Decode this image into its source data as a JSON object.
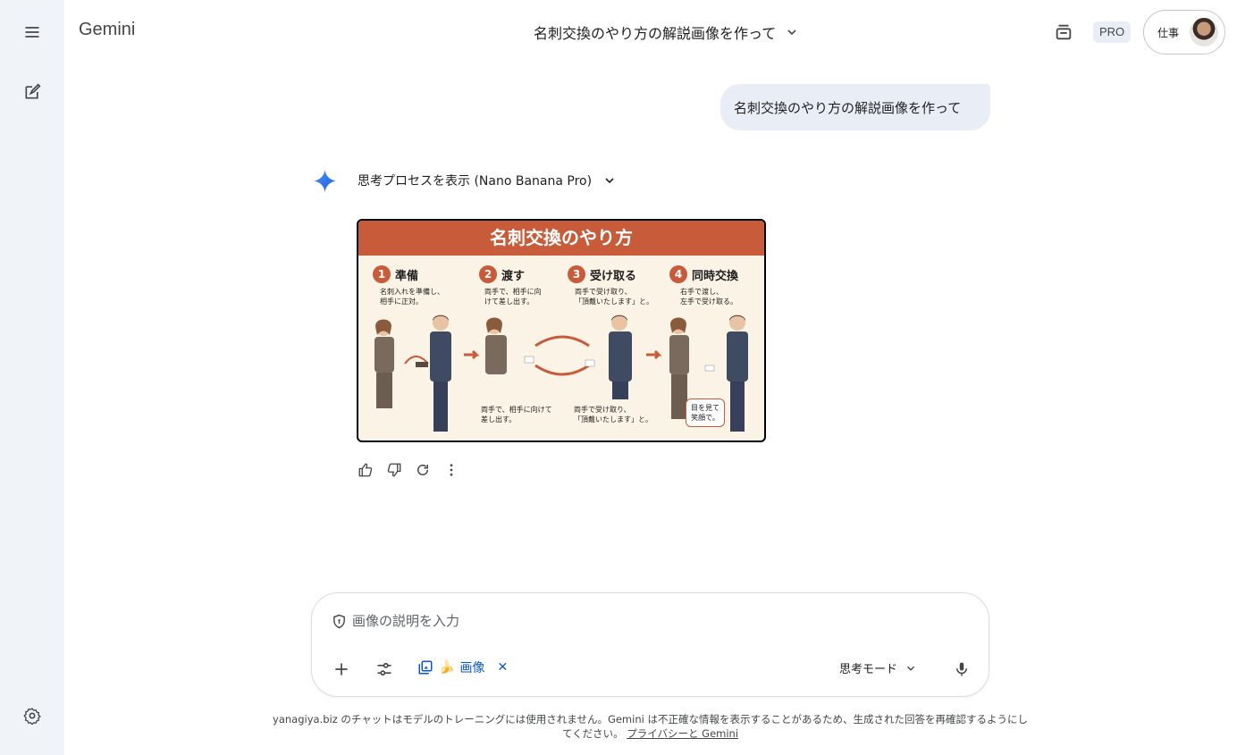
{
  "header": {
    "brand": "Gemini",
    "conversation_title": "名刺交換のやり方の解説画像を作って",
    "plan_badge": "PRO",
    "account_label": "仕事"
  },
  "sidebar": {
    "menu_icon": "menu-icon",
    "new_chat_icon": "edit-icon",
    "settings_icon": "gear-icon"
  },
  "chat": {
    "user_message": "名刺交換のやり方の解説画像を作って",
    "thought_toggle_label": "思考プロセスを表示 (Nano Banana Pro)",
    "image": {
      "title": "名刺交換のやり方",
      "steps": [
        {
          "num": "1",
          "title": "準備",
          "text": "名刺入れを準備し、\n相手に正対。"
        },
        {
          "num": "2",
          "title": "渡す",
          "text": "両手で、相手に向\nけて差し出す。"
        },
        {
          "num": "3",
          "title": "受け取る",
          "text": "両手で受け取り、\n「頂戴いたします」と。"
        },
        {
          "num": "4",
          "title": "同時交換",
          "text": "右手で渡し、\n左手で受け取る。"
        }
      ],
      "captions": {
        "give": "両手で、相手に向けて\n差し出す。",
        "receive": "両手で受け取り、\n「頂戴いたします」と。",
        "speech": "目を見て\n笑顔で。"
      }
    }
  },
  "composer": {
    "placeholder": "画像の説明を入力",
    "chip_emoji": "🍌",
    "chip_label": "画像",
    "chip_close": "✕",
    "mode_label": "思考モード"
  },
  "footer": {
    "disclaimer": "yanagiya.biz のチャットはモデルのトレーニングには使用されません。Gemini は不正確な情報を表示することがあるため、生成された回答を再確認するようにしてください。",
    "link_label": "プライバシーと Gemini"
  },
  "colors": {
    "rail_bg": "#f0f4f9",
    "bubble_bg": "#e9eef6",
    "accent_blue": "#0b57d0",
    "image_banner": "#c75b3a"
  }
}
